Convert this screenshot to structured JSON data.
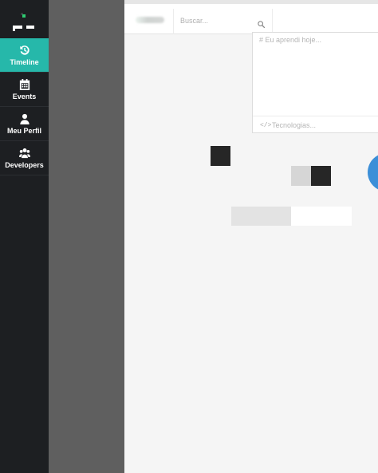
{
  "sidebar": {
    "items": [
      {
        "label": "Timeline",
        "icon": "history-icon",
        "active": true
      },
      {
        "label": "Events",
        "icon": "calendar-icon",
        "active": false
      },
      {
        "label": "Meu Perfil",
        "icon": "user-icon",
        "active": false
      },
      {
        "label": "Developers",
        "icon": "users-icon",
        "active": false
      }
    ]
  },
  "header": {
    "search_placeholder": "Buscar..."
  },
  "composer": {
    "post_placeholder": "# Eu aprendi hoje...",
    "tags_placeholder": "Tecnologias..."
  },
  "colors": {
    "sidebar_bg": "#1d1f22",
    "accent": "#26b8aa",
    "panel_gray": "#5f5f5f",
    "main_bg": "#f5f5f5",
    "blue": "#3c8fd8"
  }
}
